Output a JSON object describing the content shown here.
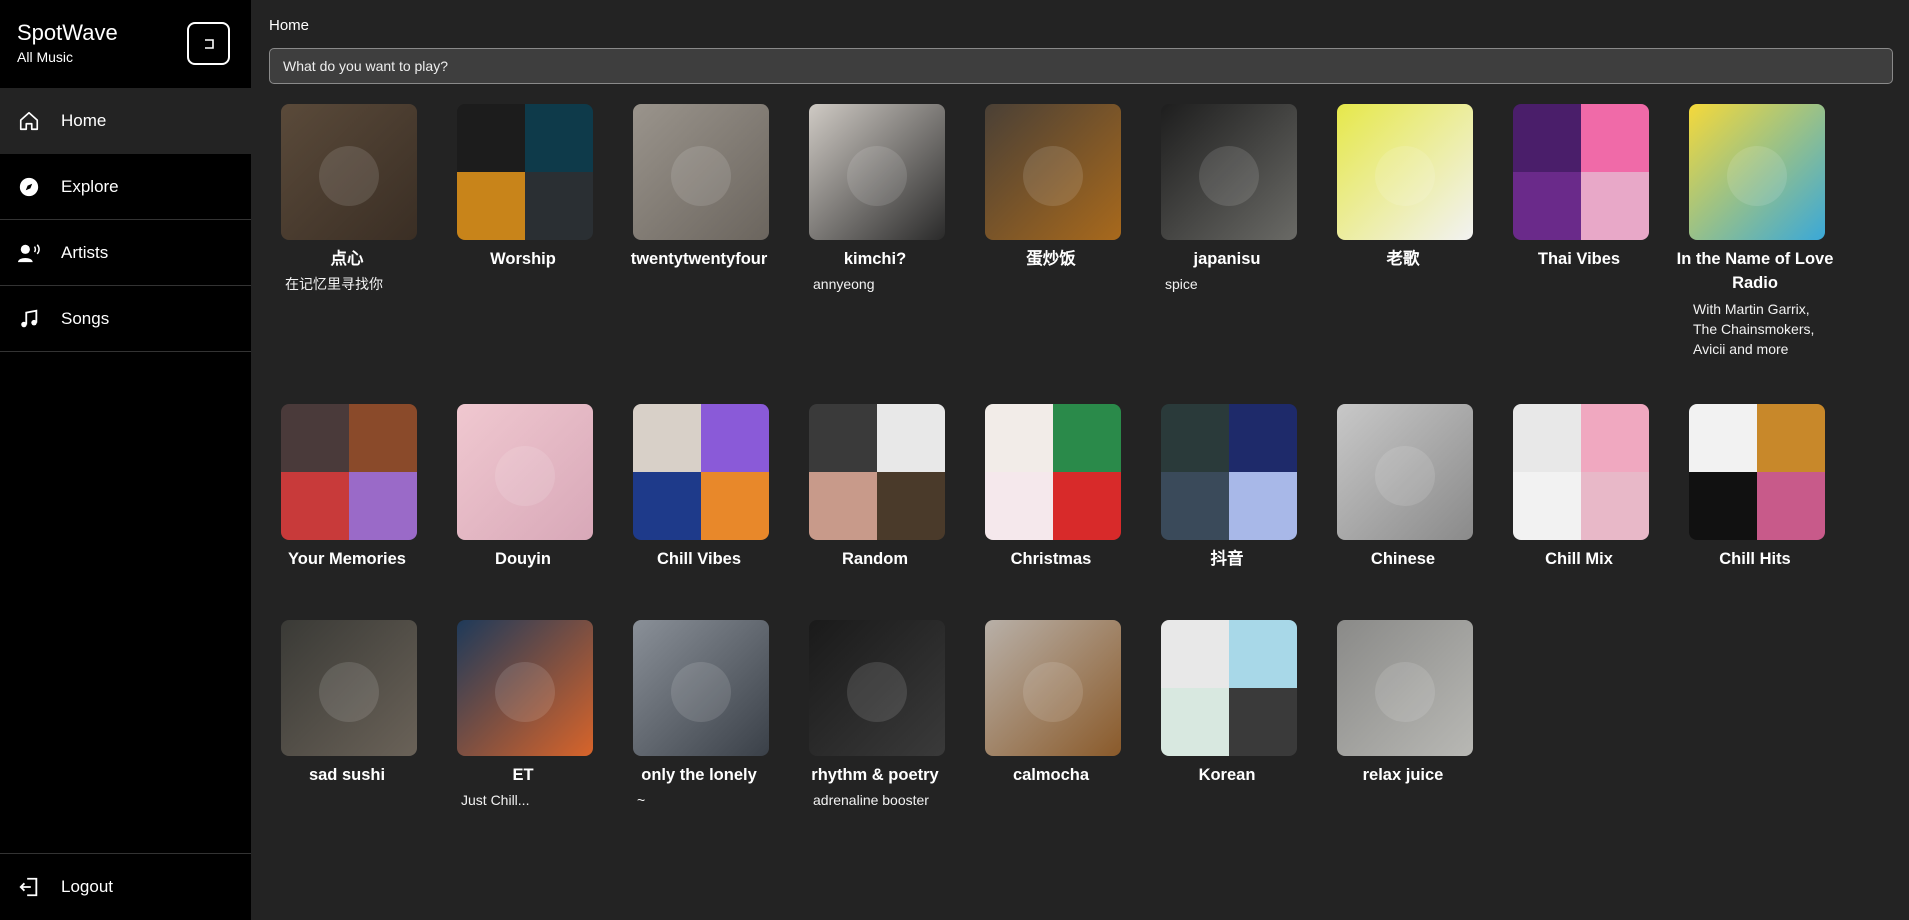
{
  "app": {
    "name": "SpotWave",
    "subtitle": "All Music"
  },
  "sidebar": {
    "items": [
      {
        "label": "Home",
        "icon": "home-icon",
        "active": true
      },
      {
        "label": "Explore",
        "icon": "compass-icon",
        "active": false
      },
      {
        "label": "Artists",
        "icon": "artist-icon",
        "active": false
      },
      {
        "label": "Songs",
        "icon": "music-note-icon",
        "active": false
      }
    ],
    "logout_label": "Logout"
  },
  "main": {
    "breadcrumb": "Home",
    "search_placeholder": "What do you want to play?"
  },
  "playlists": [
    {
      "title": "点心",
      "subtitle": "在记忆里寻找你",
      "cover": [
        "#5a4a3a",
        "#3a2e24"
      ]
    },
    {
      "title": "Worship",
      "subtitle": "",
      "cover": [
        "#1c1c1c",
        "#0e3a4a",
        "#c8841a",
        "#2a2f33"
      ]
    },
    {
      "title": "twentytwentyfour",
      "subtitle": "",
      "cover": [
        "#9a948c",
        "#6b655e"
      ]
    },
    {
      "title": "kimchi?",
      "subtitle": "annyeong",
      "cover": [
        "#cfcac4",
        "#2a2a2a"
      ]
    },
    {
      "title": "蛋炒饭",
      "subtitle": "",
      "cover": [
        "#4a4036",
        "#a8691c"
      ]
    },
    {
      "title": "japanisu",
      "subtitle": "spice",
      "cover": [
        "#1e1e1e",
        "#6a6a66"
      ]
    },
    {
      "title": "老歌",
      "subtitle": "",
      "cover": [
        "#e6e84a",
        "#f2f2f2"
      ]
    },
    {
      "title": "Thai Vibes",
      "subtitle": "",
      "cover": [
        "#4a1e6a",
        "#f06aa8",
        "#6a2a8a",
        "#e8a8c8"
      ]
    },
    {
      "title": "In the Name of Love Radio",
      "subtitle": "With Martin Garrix, The Chainsmokers, Avicii and more",
      "cover": [
        "#f5d93a",
        "#3aa8d8"
      ]
    },
    {
      "title": "Your Memories",
      "subtitle": "",
      "cover": [
        "#4a3a3a",
        "#8a4a2a",
        "#c83a3a",
        "#9a6ac8"
      ]
    },
    {
      "title": "Douyin",
      "subtitle": "",
      "cover": [
        "#f0c8d0",
        "#d8a8b8"
      ]
    },
    {
      "title": "Chill Vibes",
      "subtitle": "",
      "cover": [
        "#d8d0c8",
        "#8a5ad8",
        "#1e3a8a",
        "#e8882a"
      ]
    },
    {
      "title": "Random",
      "subtitle": "",
      "cover": [
        "#3a3a3a",
        "#e8e8e8",
        "#c89a8a",
        "#4a3a2a"
      ]
    },
    {
      "title": "Christmas",
      "subtitle": "",
      "cover": [
        "#f2ece8",
        "#2a8a4a",
        "#f5e8ec",
        "#d82a2a"
      ]
    },
    {
      "title": "抖音",
      "subtitle": "",
      "cover": [
        "#2a3a3a",
        "#1e2a6a",
        "#3a4a5a",
        "#a8b8e8"
      ]
    },
    {
      "title": "Chinese",
      "subtitle": "",
      "cover": [
        "#c8c8c8",
        "#8a8a8a"
      ]
    },
    {
      "title": "Chill Mix",
      "subtitle": "",
      "cover": [
        "#e8e8e8",
        "#f0a8c0",
        "#f2f2f2",
        "#e8b8c8"
      ]
    },
    {
      "title": "Chill Hits",
      "subtitle": "",
      "cover": [
        "#f2f2f2",
        "#c8882a",
        "#111111",
        "#c85a8a"
      ]
    },
    {
      "title": "sad sushi",
      "subtitle": "",
      "cover": [
        "#3a3a36",
        "#6a6258"
      ]
    },
    {
      "title": "ET",
      "subtitle": "Just Chill...",
      "cover": [
        "#1e3a5a",
        "#d8642a"
      ]
    },
    {
      "title": "only the lonely",
      "subtitle": "~",
      "cover": [
        "#8a9098",
        "#3a4048"
      ]
    },
    {
      "title": "rhythm & poetry",
      "subtitle": "adrenaline booster",
      "cover": [
        "#1a1a1a",
        "#3a3a3a"
      ]
    },
    {
      "title": "calmocha",
      "subtitle": "",
      "cover": [
        "#b8b0a8",
        "#8a5a2a"
      ]
    },
    {
      "title": "Korean",
      "subtitle": "",
      "cover": [
        "#e8e8e8",
        "#a8d8e8",
        "#d8e8e0",
        "#3a3a3a"
      ]
    },
    {
      "title": "relax juice",
      "subtitle": "",
      "cover": [
        "#8a8a88",
        "#b8b8b4"
      ]
    }
  ]
}
